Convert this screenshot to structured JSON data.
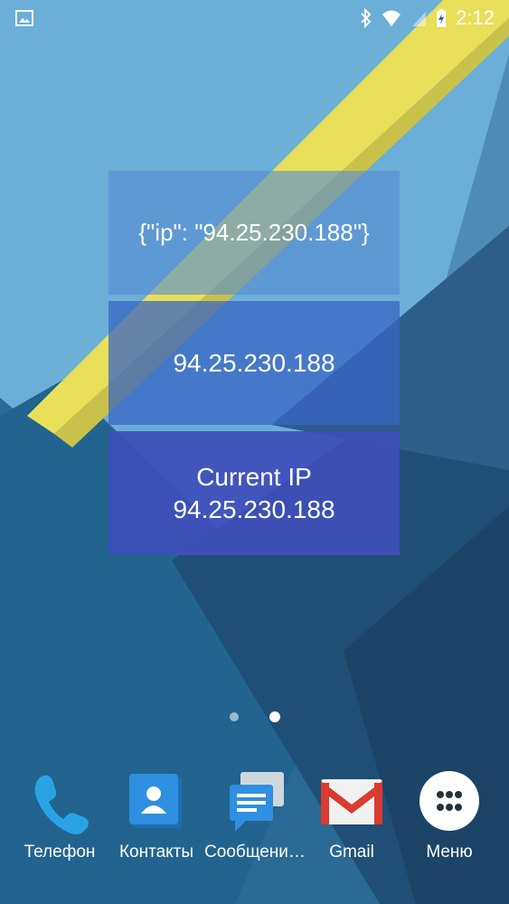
{
  "status_bar": {
    "time": "2:12",
    "notification_icon": "image-notification-icon",
    "icons": [
      "bluetooth-icon",
      "wifi-icon",
      "signal-icon",
      "battery-charging-icon"
    ]
  },
  "widgets": {
    "json": {
      "text": "{\"ip\": \"94.25.230.188\"}"
    },
    "plain": {
      "text": "94.25.230.188"
    },
    "current": {
      "title": "Current IP",
      "ip": "94.25.230.188"
    }
  },
  "page_indicator": {
    "pages": 2,
    "active_page": 2
  },
  "dock": {
    "items": [
      {
        "label": "Телефон",
        "icon": "phone-icon"
      },
      {
        "label": "Контакты",
        "icon": "contacts-icon"
      },
      {
        "label": "Сообщени…",
        "icon": "messages-icon"
      },
      {
        "label": "Gmail",
        "icon": "gmail-icon"
      },
      {
        "label": "Меню",
        "icon": "app-drawer-icon"
      }
    ]
  },
  "colors": {
    "wallpaper_sky": "#6baed8",
    "wallpaper_dark": "#1f5a80",
    "stripe": "#e8df5a",
    "widget_dark": "#3e50ba"
  }
}
